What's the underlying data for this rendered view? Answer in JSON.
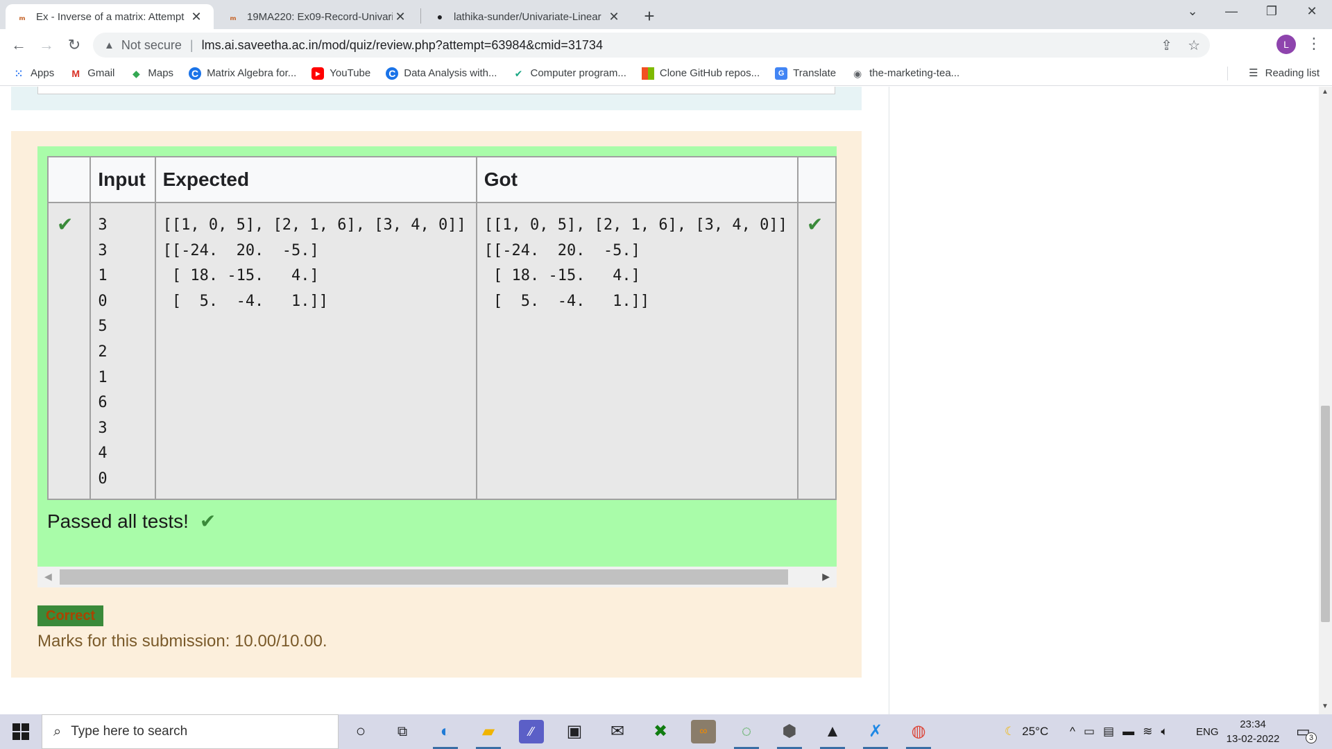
{
  "browser": {
    "tabs": [
      {
        "label": "Ex - Inverse of a matrix: Attempt",
        "favicon": "moodle-icon",
        "active": true
      },
      {
        "label": "19MA220: Ex09-Record-Univariat",
        "favicon": "moodle-icon",
        "active": false
      },
      {
        "label": "lathika-sunder/Univariate-Linear",
        "favicon": "github-icon",
        "active": false
      }
    ],
    "not_secure": "Not secure",
    "url": "lms.ai.saveetha.ac.in/mod/quiz/review.php?attempt=63984&cmid=31734",
    "profile_initial": "L",
    "bookmarks": [
      {
        "label": "Apps",
        "icon": "apps-grid-icon"
      },
      {
        "label": "Gmail",
        "icon": "gmail-icon"
      },
      {
        "label": "Maps",
        "icon": "maps-icon"
      },
      {
        "label": "Matrix Algebra for...",
        "icon": "c-logo-icon"
      },
      {
        "label": "YouTube",
        "icon": "youtube-icon"
      },
      {
        "label": "Data Analysis with...",
        "icon": "c-logo-icon"
      },
      {
        "label": "Computer program...",
        "icon": "shield-check-icon"
      },
      {
        "label": "Clone GitHub repos...",
        "icon": "windows-logo-icon"
      },
      {
        "label": "Translate",
        "icon": "translate-icon"
      },
      {
        "label": "the-marketing-tea...",
        "icon": "globe-icon"
      }
    ],
    "reading_list": "Reading list"
  },
  "results": {
    "headers": [
      "",
      "Input",
      "Expected",
      "Got",
      ""
    ],
    "input": "3\n3\n1\n0\n5\n2\n1\n6\n3\n4\n0",
    "expected": "[[1, 0, 5], [2, 1, 6], [3, 4, 0]]\n[[-24.  20.  -5.]\n [ 18. -15.   4.]\n [  5.  -4.   1.]]",
    "got": "[[1, 0, 5], [2, 1, 6], [3, 4, 0]]\n[[-24.  20.  -5.]\n [ 18. -15.   4.]\n [  5.  -4.   1.]]",
    "passed_text": "Passed all tests!",
    "status_badge": "Correct",
    "marks_text": "Marks for this submission: 10.00/10.00."
  },
  "taskbar": {
    "search_placeholder": "Type here to search",
    "weather": "25°C",
    "language": "ENG",
    "time": "23:34",
    "date": "13-02-2022",
    "notification_count": "3"
  },
  "colors": {
    "pass_green": "#a9fca9",
    "feedback_bg": "#fcefdc",
    "tick_green": "#3a8a3a"
  }
}
